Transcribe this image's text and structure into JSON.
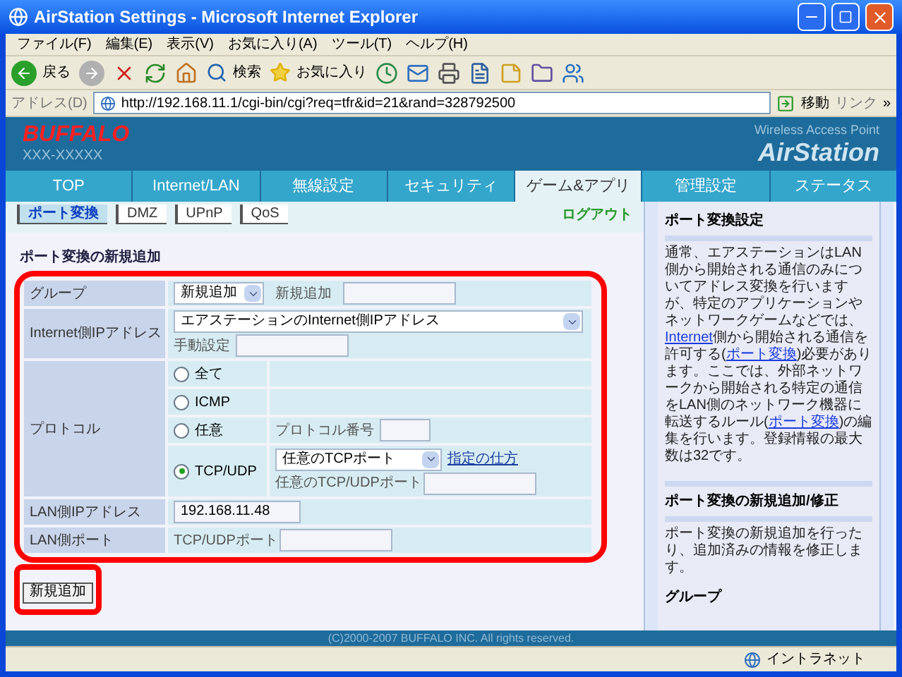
{
  "window": {
    "title": "AirStation Settings - Microsoft Internet Explorer"
  },
  "menu": [
    "ファイル(F)",
    "編集(E)",
    "表示(V)",
    "お気に入り(A)",
    "ツール(T)",
    "ヘルプ(H)"
  ],
  "toolbar": {
    "back": "戻る",
    "search": "検索",
    "favorites": "お気に入り"
  },
  "address_bar": {
    "label": "アドレス(D)",
    "url": "http://192.168.11.1/cgi-bin/cgi?req=tfr&id=21&rand=328792500",
    "go": "移動",
    "links": "リンク",
    "more": "»"
  },
  "banner": {
    "logo": "BUFFALO",
    "model": "XXX-XXXXX",
    "subtitle": "Wireless Access Point",
    "product": "AirStation"
  },
  "nav_tabs": [
    {
      "label": "TOP",
      "selected": false
    },
    {
      "label": "Internet/LAN",
      "selected": false
    },
    {
      "label": "無線設定",
      "selected": false
    },
    {
      "label": "セキュリティ",
      "selected": false
    },
    {
      "label": "ゲーム&アプリ",
      "selected": true
    },
    {
      "label": "管理設定",
      "selected": false
    },
    {
      "label": "ステータス",
      "selected": false
    }
  ],
  "sub_tabs": [
    {
      "label": "ポート変換",
      "selected": true
    },
    {
      "label": "DMZ",
      "selected": false
    },
    {
      "label": "UPnP",
      "selected": false
    },
    {
      "label": "QoS",
      "selected": false
    }
  ],
  "logout": "ログアウト",
  "form": {
    "title": "ポート変換の新規追加",
    "group": {
      "label": "グループ",
      "select": "新規追加",
      "new_label": "新規追加"
    },
    "internet_ip": {
      "label": "Internet側IPアドレス",
      "select": "エアステーションのInternet側IPアドレス",
      "manual_label": "手動設定"
    },
    "protocol": {
      "label": "プロトコル",
      "options": [
        {
          "kind": "plain",
          "label": "全て",
          "selected": false
        },
        {
          "kind": "plain",
          "label": "ICMP",
          "selected": false
        },
        {
          "kind": "number",
          "label": "任意",
          "selected": false,
          "field_label": "プロトコル番号"
        },
        {
          "kind": "port",
          "label": "TCP/UDP",
          "selected": true,
          "select": "任意のTCPポート",
          "help_link": "指定の仕方",
          "field_label": "任意のTCP/UDPポート"
        }
      ]
    },
    "lan_ip": {
      "label": "LAN側IPアドレス",
      "value": "192.168.11.48"
    },
    "lan_port": {
      "label": "LAN側ポート",
      "field_label": "TCP/UDPポート"
    },
    "submit": "新規追加"
  },
  "help": {
    "title": "ポート変換設定",
    "paragraph": [
      {
        "text": "通常、エアステーションはLAN側から開始される通信のみについてアドレス変換を行いますが、特定のアプリケーションやネットワークゲームなどでは、",
        "link": false
      },
      {
        "text": "Internet",
        "link": true
      },
      {
        "text": "側から開始される通信を許可する(",
        "link": false
      },
      {
        "text": "ポート変換",
        "link": true
      },
      {
        "text": ")必要があります。ここでは、外部ネットワークから開始される特定の通信をLAN側のネットワーク機器に転送するルール(",
        "link": false
      },
      {
        "text": "ポート変換",
        "link": true
      },
      {
        "text": ")の編集を行います。登録情報の最大数は32です。",
        "link": false
      }
    ],
    "section_title": "ポート変換の新規追加/修正",
    "section_text": "ポート変換の新規追加を行ったり、追加済みの情報を修正します。",
    "group_title": "グループ"
  },
  "copyright": "(C)2000-2007 BUFFALO INC. All rights reserved.",
  "status_bar": {
    "zone": "イントラネット"
  }
}
